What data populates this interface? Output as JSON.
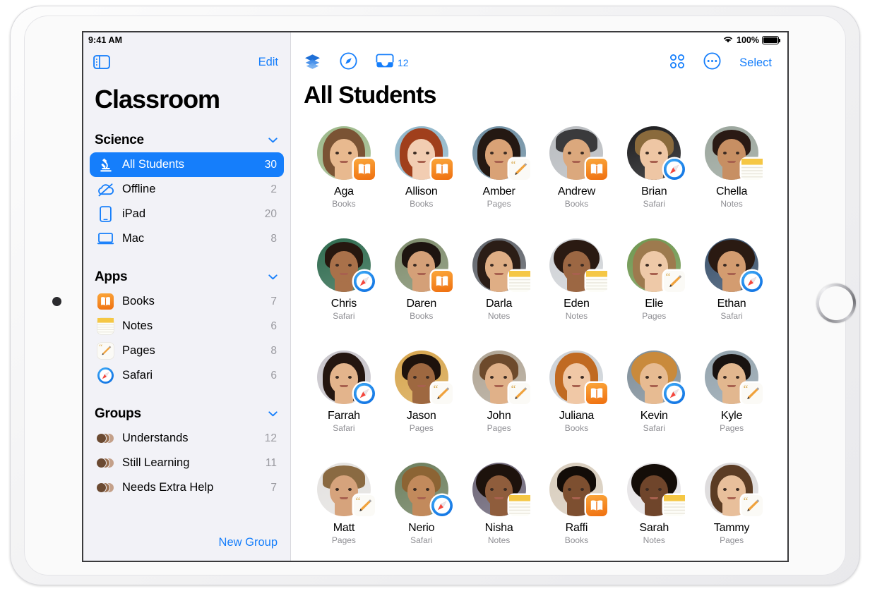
{
  "colors": {
    "accent": "#157efb",
    "sidebar_bg": "#f2f2f7",
    "count_text": "#9a9aa0",
    "secondary_text": "#8e8e93",
    "books": "#f08020",
    "notes": "#f5c744",
    "pages": "#f7a73c",
    "safari": "#1d9bf5"
  },
  "status_bar": {
    "time": "9:41 AM",
    "wifi_icon": "wifi-icon",
    "battery_percent": "100%",
    "battery_icon": "battery-full-icon"
  },
  "sidebar": {
    "toggle_icon": "sidebar-toggle-icon",
    "edit_label": "Edit",
    "title": "Classroom",
    "new_group_label": "New Group",
    "sections": [
      {
        "title": "Science",
        "collapse_icon": "chevron-down-icon",
        "items": [
          {
            "label": "All Students",
            "count": "30",
            "icon": "microscope-icon",
            "selected": true
          },
          {
            "label": "Offline",
            "count": "2",
            "icon": "cloud-slash-icon",
            "selected": false
          },
          {
            "label": "iPad",
            "count": "20",
            "icon": "ipad-icon",
            "selected": false
          },
          {
            "label": "Mac",
            "count": "8",
            "icon": "mac-icon",
            "selected": false
          }
        ]
      },
      {
        "title": "Apps",
        "collapse_icon": "chevron-down-icon",
        "items": [
          {
            "label": "Books",
            "count": "7",
            "icon": "books-app-icon",
            "selected": false
          },
          {
            "label": "Notes",
            "count": "6",
            "icon": "notes-app-icon",
            "selected": false
          },
          {
            "label": "Pages",
            "count": "8",
            "icon": "pages-app-icon",
            "selected": false
          },
          {
            "label": "Safari",
            "count": "6",
            "icon": "safari-app-icon",
            "selected": false
          }
        ]
      },
      {
        "title": "Groups",
        "collapse_icon": "chevron-down-icon",
        "items": [
          {
            "label": "Understands",
            "count": "12",
            "icon": "group-avatars-icon",
            "selected": false
          },
          {
            "label": "Still Learning",
            "count": "11",
            "icon": "group-avatars-icon",
            "selected": false
          },
          {
            "label": "Needs Extra Help",
            "count": "7",
            "icon": "group-avatars-icon",
            "selected": false
          }
        ]
      }
    ]
  },
  "main": {
    "title": "All Students",
    "toolbar": {
      "layers_icon": "layers-icon",
      "navigate_icon": "navigate-compass-icon",
      "inbox_icon": "inbox-tray-icon",
      "inbox_count": "12",
      "grid_icon": "grid-view-icon",
      "more_icon": "ellipsis-circle-icon",
      "select_label": "Select"
    },
    "students": [
      {
        "name": "Aga",
        "app": "Books",
        "badge": "books",
        "skin": "#e8b98f",
        "hair": "#7a5334",
        "bg": "#9db98a",
        "hairstyle": "long"
      },
      {
        "name": "Allison",
        "app": "Books",
        "badge": "books",
        "skin": "#f2cdb2",
        "hair": "#a03f1c",
        "bg": "#8fb6c9",
        "hairstyle": "long"
      },
      {
        "name": "Amber",
        "app": "Pages",
        "badge": "pages",
        "skin": "#d9a276",
        "hair": "#241812",
        "bg": "#6f8fa3",
        "hairstyle": "long"
      },
      {
        "name": "Andrew",
        "app": "Books",
        "badge": "books",
        "skin": "#dba87d",
        "hair": "#3a3a3c",
        "bg": "#b9bcc0",
        "hairstyle": "cap"
      },
      {
        "name": "Brian",
        "app": "Safari",
        "badge": "safari",
        "skin": "#eec6a4",
        "hair": "#8a6a3c",
        "bg": "#1c1c1e",
        "hairstyle": "short"
      },
      {
        "name": "Chella",
        "app": "Notes",
        "badge": "notes",
        "skin": "#c78f63",
        "hair": "#2a1a14",
        "bg": "#9aa59c",
        "hairstyle": "short"
      },
      {
        "name": "Chris",
        "app": "Safari",
        "badge": "safari",
        "skin": "#a9714a",
        "hair": "#26170f",
        "bg": "#2f6b4f",
        "hairstyle": "short"
      },
      {
        "name": "Daren",
        "app": "Books",
        "badge": "books",
        "skin": "#d4a078",
        "hair": "#1d1410",
        "bg": "#7f8d6d",
        "hairstyle": "short"
      },
      {
        "name": "Darla",
        "app": "Notes",
        "badge": "notes",
        "skin": "#dfae85",
        "hair": "#2b1d16",
        "bg": "#60646b",
        "hairstyle": "long"
      },
      {
        "name": "Eden",
        "app": "Notes",
        "badge": "notes",
        "skin": "#9c6743",
        "hair": "#2a1a12",
        "bg": "#cfd2d6",
        "hairstyle": "curly"
      },
      {
        "name": "Elie",
        "app": "Pages",
        "badge": "pages",
        "skin": "#eec9a8",
        "hair": "#9d7a4e",
        "bg": "#6f9750",
        "hairstyle": "long"
      },
      {
        "name": "Ethan",
        "app": "Safari",
        "badge": "safari",
        "skin": "#d39c70",
        "hair": "#2a1a12",
        "bg": "#38506b",
        "hairstyle": "curly"
      },
      {
        "name": "Farrah",
        "app": "Safari",
        "badge": "safari",
        "skin": "#e3b48c",
        "hair": "#241610",
        "bg": "#c9c6cc",
        "hairstyle": "long"
      },
      {
        "name": "Jason",
        "app": "Pages",
        "badge": "pages",
        "skin": "#9e6840",
        "hair": "#1d120c",
        "bg": "#d7a64e",
        "hairstyle": "short"
      },
      {
        "name": "John",
        "app": "Pages",
        "badge": "pages",
        "skin": "#e0b189",
        "hair": "#6d4a2c",
        "bg": "#b0a595",
        "hairstyle": "short"
      },
      {
        "name": "Juliana",
        "app": "Books",
        "badge": "books",
        "skin": "#f0c8a6",
        "hair": "#c06a22",
        "bg": "#cdd2d7",
        "hairstyle": "long"
      },
      {
        "name": "Kevin",
        "app": "Safari",
        "badge": "safari",
        "skin": "#e7bb92",
        "hair": "#c98a3c",
        "bg": "#7f8e99",
        "hairstyle": "curly"
      },
      {
        "name": "Kyle",
        "app": "Pages",
        "badge": "pages",
        "skin": "#e2b78f",
        "hair": "#181210",
        "bg": "#93a3ad",
        "hairstyle": "short"
      },
      {
        "name": "Matt",
        "app": "Pages",
        "badge": "pages",
        "skin": "#d6a37c",
        "hair": "#8a6a42",
        "bg": "#e4e2e0",
        "hairstyle": "cap"
      },
      {
        "name": "Nerio",
        "app": "Safari",
        "badge": "safari",
        "skin": "#c28a5c",
        "hair": "#8c6434",
        "bg": "#6d7f5e",
        "hairstyle": "short"
      },
      {
        "name": "Nisha",
        "app": "Notes",
        "badge": "notes",
        "skin": "#8f5d3c",
        "hair": "#1d120c",
        "bg": "#6b6476",
        "hairstyle": "curly"
      },
      {
        "name": "Raffi",
        "app": "Books",
        "badge": "books",
        "skin": "#7d4f30",
        "hair": "#120c08",
        "bg": "#d8cdbd",
        "hairstyle": "short"
      },
      {
        "name": "Sarah",
        "app": "Notes",
        "badge": "notes",
        "skin": "#6f452b",
        "hair": "#140d08",
        "bg": "#e6e4e6",
        "hairstyle": "curly"
      },
      {
        "name": "Tammy",
        "app": "Pages",
        "badge": "pages",
        "skin": "#e8bf9b",
        "hair": "#5b3c24",
        "bg": "#dcdadb",
        "hairstyle": "long"
      }
    ]
  }
}
